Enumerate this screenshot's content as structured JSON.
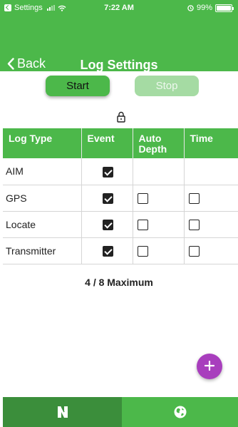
{
  "status_bar": {
    "carrier": "Settings",
    "time": "7:22 AM",
    "battery": "99%",
    "battery_level": 0.99
  },
  "nav": {
    "back_label": "Back",
    "title": "Log Settings"
  },
  "controls": {
    "start_label": "Start",
    "stop_label": "Stop"
  },
  "table": {
    "headers": {
      "log_type": "Log Type",
      "event": "Event",
      "auto_depth_line1": "Auto",
      "auto_depth_line2": "Depth",
      "time": "Time"
    },
    "rows": [
      {
        "log_type": "AIM",
        "event": true,
        "auto_depth": null,
        "time": null
      },
      {
        "log_type": "GPS",
        "event": true,
        "auto_depth": false,
        "time": false
      },
      {
        "log_type": "Locate",
        "event": true,
        "auto_depth": false,
        "time": false
      },
      {
        "log_type": "Transmitter",
        "event": true,
        "auto_depth": false,
        "time": false
      }
    ]
  },
  "summary": {
    "maximum_text": "4 / 8 Maximum"
  },
  "fab": {
    "icon": "plus-icon",
    "color": "#a83ebd"
  },
  "tabs": [
    {
      "icon": "app-logo-icon",
      "active": true
    },
    {
      "icon": "globe-icon",
      "active": false
    }
  ],
  "colors": {
    "primary": "#4cb84a",
    "primary_dark": "#3b8e3b",
    "disabled": "#a5dba3",
    "accent": "#a83ebd"
  }
}
